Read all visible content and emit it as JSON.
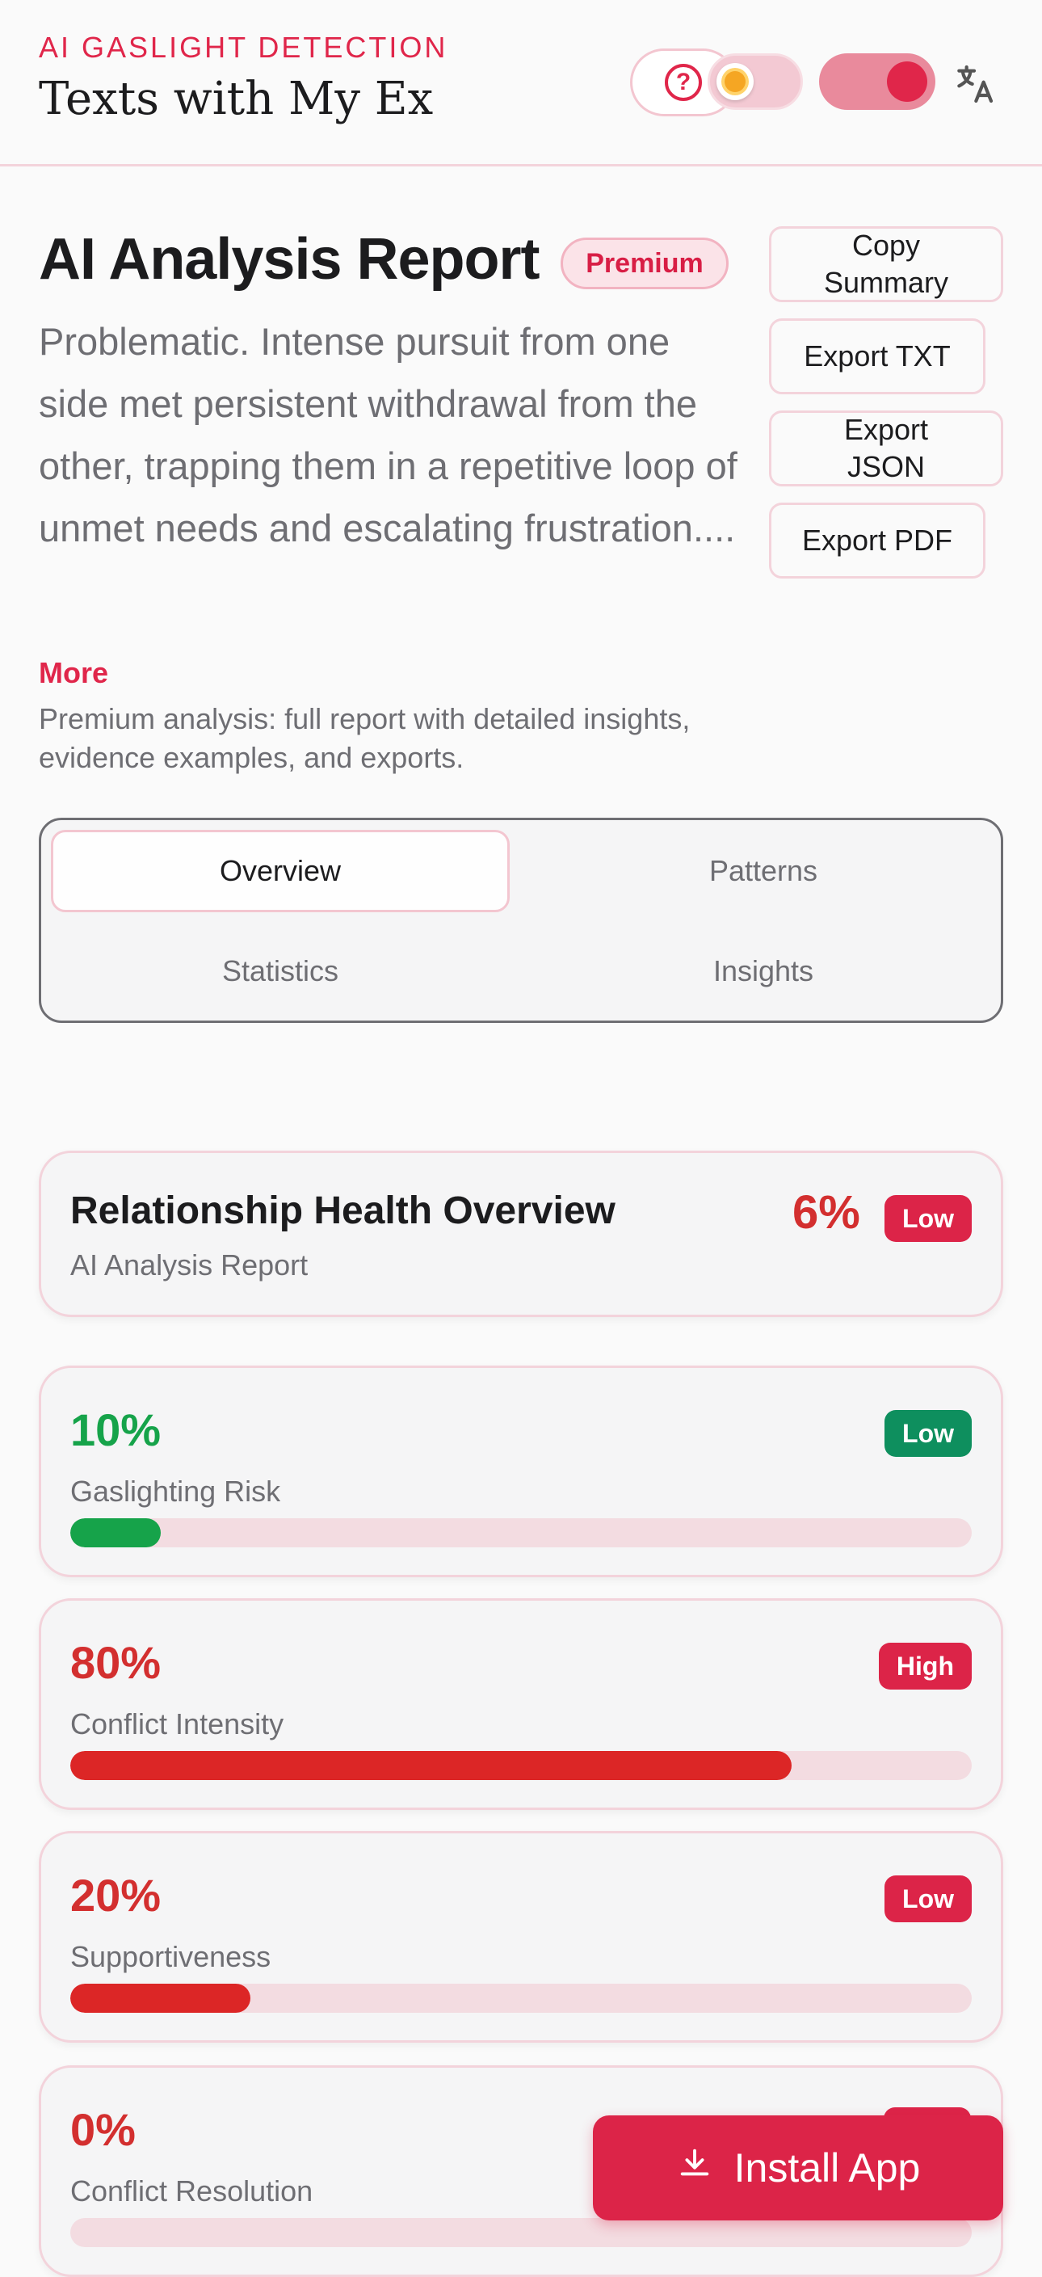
{
  "header": {
    "eyebrow": "AI GASLIGHT DETECTION",
    "title": "Texts with My Ex",
    "help_icon": "question-circle-icon",
    "theme_toggle_icon": "sun-icon",
    "translate_icon": "translate-icon",
    "accent_color": "#e0264a"
  },
  "report": {
    "title": "AI Analysis Report",
    "badge": "Premium",
    "summary": "Problematic. Intense pursuit from one side met persistent withdrawal from the other, trapping them in a repetitive loop of unmet needs and escalating frustration....",
    "more_label": "More",
    "premium_note": "Premium analysis: full report with detailed insights, evidence examples, and exports.",
    "actions": {
      "copy_summary": "Copy Summary",
      "export_txt": "Export TXT",
      "export_json": "Export JSON",
      "export_pdf": "Export PDF"
    }
  },
  "tabs": [
    {
      "label": "Overview",
      "active": true
    },
    {
      "label": "Patterns",
      "active": false
    },
    {
      "label": "Statistics",
      "active": false
    },
    {
      "label": "Insights",
      "active": false
    }
  ],
  "overview": {
    "title": "Relationship Health Overview",
    "subtitle": "AI Analysis Report",
    "score": "6%",
    "level": "Low"
  },
  "metrics": [
    {
      "value": "10%",
      "label": "Gaslighting Risk",
      "level": "Low",
      "fill_percent": 10,
      "color": "#16a34a",
      "badge_color": "#0e8f5e"
    },
    {
      "value": "80%",
      "label": "Conflict Intensity",
      "level": "High",
      "fill_percent": 80,
      "color": "#dc2626",
      "badge_color": "#dc2448"
    },
    {
      "value": "20%",
      "label": "Supportiveness",
      "level": "Low",
      "fill_percent": 20,
      "color": "#dc2626",
      "badge_color": "#dc2448"
    },
    {
      "value": "0%",
      "label": "Conflict Resolution",
      "fill_percent": 0,
      "color": "#dc2626"
    }
  ],
  "install": {
    "label": "Install App",
    "icon": "download-icon"
  }
}
